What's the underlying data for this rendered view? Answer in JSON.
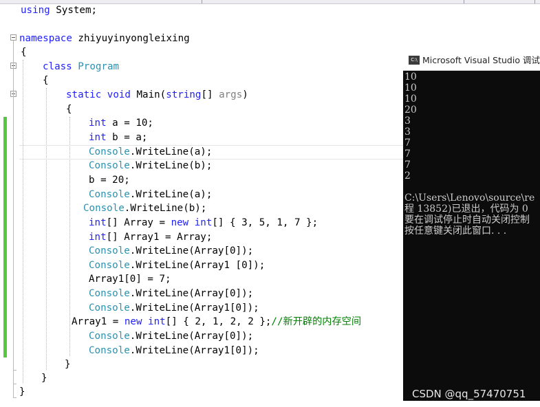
{
  "editor": {
    "lines": [
      [
        {
          "t": "using",
          "c": "kw"
        },
        {
          "t": " System;"
        }
      ],
      [
        {
          "t": "namespace",
          "c": "kw"
        },
        {
          "t": " zhiyuyinyongleixing"
        }
      ],
      [
        {
          "t": "{"
        }
      ],
      [
        {
          "t": "class",
          "c": "kw"
        },
        {
          "t": " "
        },
        {
          "t": "Program",
          "c": "cls"
        }
      ],
      [
        {
          "t": "{"
        }
      ],
      [
        {
          "t": "static",
          "c": "kw"
        },
        {
          "t": " "
        },
        {
          "t": "void",
          "c": "kw"
        },
        {
          "t": " Main("
        },
        {
          "t": "string",
          "c": "kw"
        },
        {
          "t": "[] "
        },
        {
          "t": "args",
          "c": "param"
        },
        {
          "t": ")"
        }
      ],
      [
        {
          "t": "{"
        }
      ],
      [
        {
          "t": "int",
          "c": "kw"
        },
        {
          "t": " a = 10;"
        }
      ],
      [
        {
          "t": "int",
          "c": "kw"
        },
        {
          "t": " b = a;"
        }
      ],
      [
        {
          "t": "Console",
          "c": "cls"
        },
        {
          "t": ".WriteLine(a);"
        }
      ],
      [
        {
          "t": "Console",
          "c": "cls"
        },
        {
          "t": ".WriteLine(b);"
        }
      ],
      [
        {
          "t": "b = 20;"
        }
      ],
      [
        {
          "t": "Console",
          "c": "cls"
        },
        {
          "t": ".WriteLine(a);"
        }
      ],
      [
        {
          "t": "Console",
          "c": "cls"
        },
        {
          "t": ".WriteLine(b);"
        }
      ],
      [
        {
          "t": "int",
          "c": "kw"
        },
        {
          "t": "[] Array = "
        },
        {
          "t": "new",
          "c": "kw"
        },
        {
          "t": " "
        },
        {
          "t": "int",
          "c": "kw"
        },
        {
          "t": "[] { 3, 5, 1, 7 };"
        }
      ],
      [
        {
          "t": "int",
          "c": "kw"
        },
        {
          "t": "[] Array1 = Array;"
        }
      ],
      [
        {
          "t": "Console",
          "c": "cls"
        },
        {
          "t": ".WriteLine(Array[0]);"
        }
      ],
      [
        {
          "t": "Console",
          "c": "cls"
        },
        {
          "t": ".WriteLine(Array1 [0]);"
        }
      ],
      [
        {
          "t": "Array1[0] = 7;"
        }
      ],
      [
        {
          "t": "Console",
          "c": "cls"
        },
        {
          "t": ".WriteLine(Array[0]);"
        }
      ],
      [
        {
          "t": "Console",
          "c": "cls"
        },
        {
          "t": ".WriteLine(Array1[0]);"
        }
      ],
      [
        {
          "t": "Array1 = "
        },
        {
          "t": "new",
          "c": "kw"
        },
        {
          "t": " "
        },
        {
          "t": "int",
          "c": "kw"
        },
        {
          "t": "[] { 2, 1, 2, 2 };"
        },
        {
          "t": "//新开辟的内存空间",
          "c": "cm"
        }
      ],
      [
        {
          "t": "Console",
          "c": "cls"
        },
        {
          "t": ".WriteLine(Array[0]);"
        }
      ],
      [
        {
          "t": "Console",
          "c": "cls"
        },
        {
          "t": ".WriteLine(Array1[0]);"
        }
      ],
      [
        {
          "t": "}"
        }
      ],
      [
        {
          "t": "}"
        }
      ],
      [
        {
          "t": "}"
        }
      ]
    ]
  },
  "console": {
    "icon_label": "C:\\",
    "title": "Microsoft Visual Studio 调试控",
    "output": [
      "10",
      "10",
      "10",
      "20",
      "3",
      "3",
      "7",
      "7",
      "7",
      "2",
      "",
      "C:\\Users\\Lenovo\\source\\re",
      "程 13852)已退出，代码为 0",
      "要在调试停止时自动关闭控制",
      "按任意键关闭此窗口. . ."
    ]
  },
  "watermark": "CSDN @qq_57470751"
}
